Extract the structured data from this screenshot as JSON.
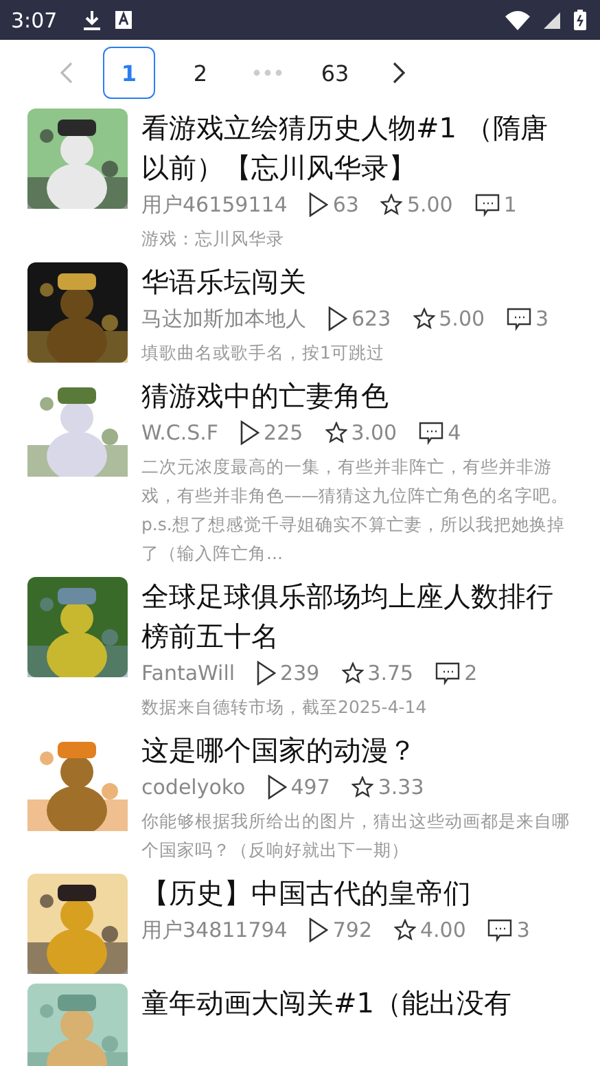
{
  "status_bar": {
    "time": "3:07"
  },
  "pagination": {
    "prev_disabled": true,
    "pages": [
      {
        "kind": "page",
        "label": "1",
        "selected": true
      },
      {
        "kind": "page",
        "label": "2",
        "selected": false
      },
      {
        "kind": "ellipsis"
      },
      {
        "kind": "page",
        "label": "63",
        "selected": false
      }
    ]
  },
  "quizzes": [
    {
      "title": "看游戏立绘猜历史人物#1 （隋唐以前）【忘川风华录】",
      "author": "用户46159114",
      "plays": "63",
      "rating": "5.00",
      "comments": "1",
      "description": "游戏：忘川风华录"
    },
    {
      "title": "华语乐坛闯关",
      "author": "马达加斯加本地人",
      "plays": "623",
      "rating": "5.00",
      "comments": "3",
      "description": "填歌曲名或歌手名，按1可跳过"
    },
    {
      "title": "猜游戏中的亡妻角色",
      "author": "W.C.S.F",
      "plays": "225",
      "rating": "3.00",
      "comments": "4",
      "description": "二次元浓度最高的一集，有些并非阵亡，有些并非游戏，有些并非角色——猜猜这九位阵亡角色的名字吧。p.s.想了想感觉千寻姐确实不算亡妻，所以我把她换掉了（输入阵亡角..."
    },
    {
      "title": "全球足球俱乐部场均上座人数排行榜前五十名",
      "author": "FantaWill",
      "plays": "239",
      "rating": "3.75",
      "comments": "2",
      "description": "数据来自德转市场，截至2025-4-14"
    },
    {
      "title": "这是哪个国家的动漫？",
      "author": "codelyoko",
      "plays": "497",
      "rating": "3.33",
      "description": "你能够根据我所给出的图片，猜出这些动画都是来自哪个国家吗？（反响好就出下一期）"
    },
    {
      "title": "【历史】中国古代的皇帝们",
      "author": "用户34811794",
      "plays": "792",
      "rating": "4.00",
      "comments": "3"
    },
    {
      "title": "童年动画大闯关#1（能出没有"
    }
  ]
}
